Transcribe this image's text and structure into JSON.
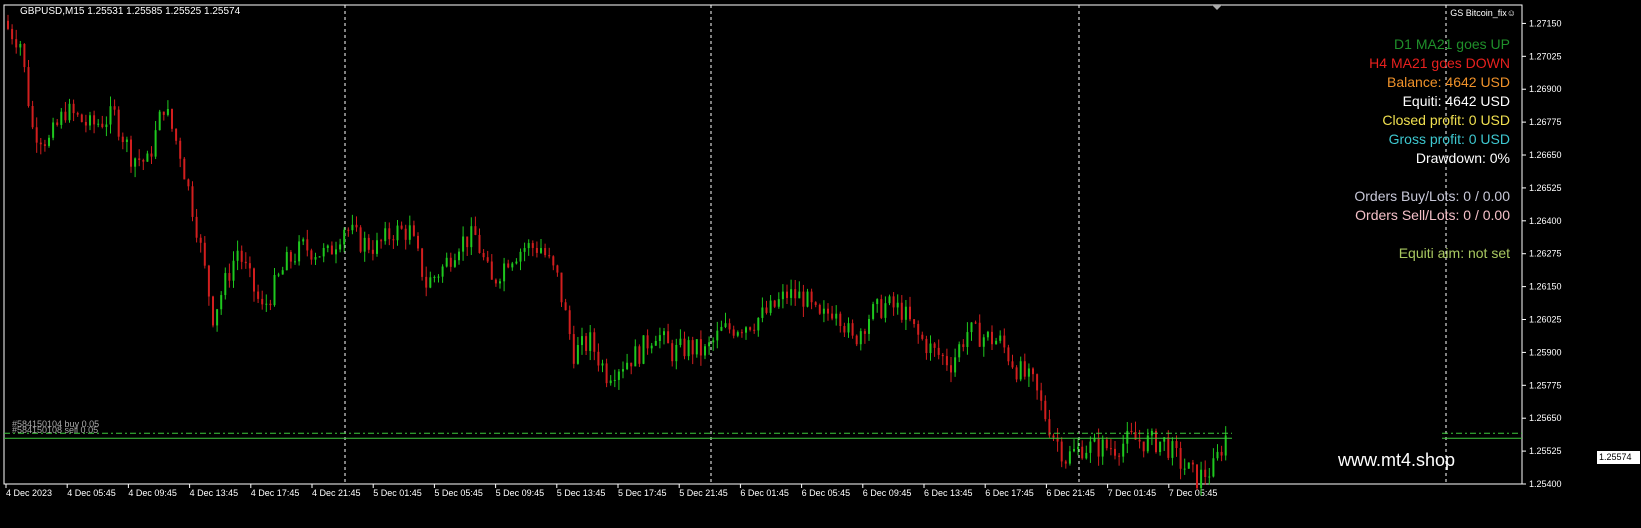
{
  "header": {
    "symbol_info": "GBPUSD,M15  1.25531 1.25585 1.25525 1.25574",
    "indicator_name": "GS Bitcoin_fix☺"
  },
  "info_panel": [
    {
      "text": "D1 MA21 goes UP",
      "color": "#1f8f2a"
    },
    {
      "text": "H4 MA21 goes DOWN",
      "color": "#e8201e"
    },
    {
      "text": "Balance: 4642 USD",
      "color": "#f0922a"
    },
    {
      "text": "Equiti: 4642 USD",
      "color": "#ffffff"
    },
    {
      "text": "Closed profit: 0 USD",
      "color": "#f0e050"
    },
    {
      "text": "Gross profit: 0 USD",
      "color": "#3ec8d0"
    },
    {
      "text": "Drawdown: 0%",
      "color": "#ffffff"
    },
    {
      "text": "Orders Buy/Lots: 0 / 0.00",
      "color": "#c8c8d8"
    },
    {
      "text": "Orders Sell/Lots: 0 / 0.00",
      "color": "#f4c0c8"
    },
    {
      "text": "Equiti aim: not set",
      "color": "#a8c860"
    }
  ],
  "watermark": "www.mt4.shop",
  "orders": [
    {
      "label": "#584150104 buy 0.05",
      "price": 1.25574
    },
    {
      "label": "#584150108 sell 0.05",
      "price": 1.25574
    }
  ],
  "current_price": "1.25574",
  "colors": {
    "up": "#1ec81e",
    "down": "#d21e1e",
    "grid": "#ffffff",
    "axis": "#ffffff",
    "order_line": "#3cc83c"
  },
  "chart_data": {
    "type": "candlestick",
    "title": "",
    "ylim": [
      1.254,
      1.2722
    ],
    "y_ticks": [
      "1.27150",
      "1.27025",
      "1.26900",
      "1.26775",
      "1.26650",
      "1.26525",
      "1.26400",
      "1.26275",
      "1.26150",
      "1.26025",
      "1.25900",
      "1.25775",
      "1.25650",
      "1.25525",
      "1.25400"
    ],
    "x_labels": [
      "4 Dec 2023",
      "4 Dec 05:45",
      "4 Dec 09:45",
      "4 Dec 13:45",
      "4 Dec 17:45",
      "4 Dec 21:45",
      "5 Dec 01:45",
      "5 Dec 05:45",
      "5 Dec 09:45",
      "5 Dec 13:45",
      "5 Dec 17:45",
      "5 Dec 21:45",
      "6 Dec 01:45",
      "6 Dec 05:45",
      "6 Dec 09:45",
      "6 Dec 13:45",
      "6 Dec 17:45",
      "6 Dec 21:45",
      "7 Dec 01:45",
      "7 Dec 05:45"
    ],
    "separators": [
      "5 Dec",
      "6 Dec",
      "7 Dec",
      "8 Dec"
    ],
    "close_keypoints": [
      [
        0,
        1.2713
      ],
      [
        3,
        1.2708
      ],
      [
        6,
        1.2675
      ],
      [
        10,
        1.267
      ],
      [
        14,
        1.2682
      ],
      [
        20,
        1.2676
      ],
      [
        26,
        1.268
      ],
      [
        30,
        1.2665
      ],
      [
        34,
        1.2662
      ],
      [
        38,
        1.2684
      ],
      [
        42,
        1.2666
      ],
      [
        46,
        1.2638
      ],
      [
        50,
        1.2604
      ],
      [
        56,
        1.2629
      ],
      [
        62,
        1.2606
      ],
      [
        68,
        1.2624
      ],
      [
        72,
        1.263
      ],
      [
        78,
        1.2627
      ],
      [
        82,
        1.2638
      ],
      [
        86,
        1.2632
      ],
      [
        90,
        1.263
      ],
      [
        94,
        1.2636
      ],
      [
        98,
        1.2636
      ],
      [
        102,
        1.2616
      ],
      [
        106,
        1.2622
      ],
      [
        110,
        1.2632
      ],
      [
        114,
        1.2634
      ],
      [
        118,
        1.2616
      ],
      [
        122,
        1.2626
      ],
      [
        126,
        1.263
      ],
      [
        130,
        1.263
      ],
      [
        134,
        1.2618
      ],
      [
        138,
        1.259
      ],
      [
        142,
        1.2594
      ],
      [
        146,
        1.2582
      ],
      [
        150,
        1.2586
      ],
      [
        154,
        1.259
      ],
      [
        158,
        1.2598
      ],
      [
        162,
        1.259
      ],
      [
        166,
        1.2592
      ],
      [
        170,
        1.259
      ],
      [
        174,
        1.2598
      ],
      [
        178,
        1.26
      ],
      [
        182,
        1.2602
      ],
      [
        186,
        1.2606
      ],
      [
        190,
        1.2612
      ],
      [
        194,
        1.2611
      ],
      [
        198,
        1.2602
      ],
      [
        202,
        1.2608
      ],
      [
        206,
        1.2594
      ],
      [
        210,
        1.2604
      ],
      [
        214,
        1.2608
      ],
      [
        218,
        1.2606
      ],
      [
        222,
        1.2596
      ],
      [
        226,
        1.259
      ],
      [
        230,
        1.2586
      ],
      [
        234,
        1.2598
      ],
      [
        238,
        1.2596
      ],
      [
        242,
        1.2594
      ],
      [
        246,
        1.2584
      ],
      [
        250,
        1.2578
      ],
      [
        254,
        1.2562
      ],
      [
        258,
        1.255
      ],
      [
        262,
        1.2554
      ],
      [
        266,
        1.2554
      ],
      [
        270,
        1.2554
      ],
      [
        274,
        1.2557
      ],
      [
        278,
        1.2556
      ],
      [
        282,
        1.2556
      ],
      [
        286,
        1.2548
      ],
      [
        290,
        1.2542
      ],
      [
        294,
        1.2546
      ],
      [
        297,
        1.2558
      ]
    ]
  }
}
